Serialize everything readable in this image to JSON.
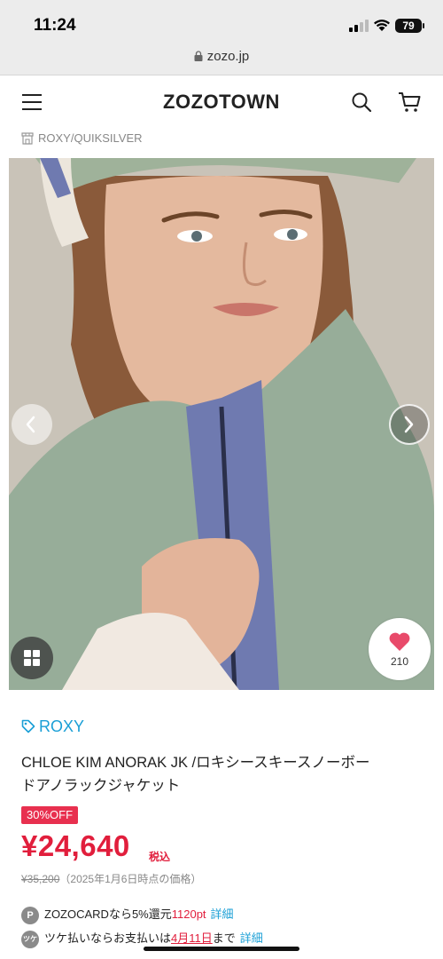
{
  "status_bar": {
    "time": "11:24",
    "battery": "79"
  },
  "browser": {
    "url": "zozo.jp"
  },
  "header": {
    "brand": "ZOZOTOWN"
  },
  "shop": {
    "name": "ROXY/QUIKSILVER"
  },
  "hero": {
    "favorite_count": "210"
  },
  "product": {
    "brand": "ROXY",
    "title_line1": "CHLOE KIM ANORAK JK /ロキシースキースノーボー",
    "title_line2": "ドアノラックジャケット",
    "discount": "30%OFF",
    "price": "¥24,640",
    "tax_label": "税込",
    "original_price": "¥35,200",
    "original_price_note": "（2025年1月6日時点の価格）"
  },
  "points": {
    "icon": "P",
    "text": "ZOZOCARDなら5%還元",
    "value": "1120pt",
    "link": "詳細"
  },
  "payment": {
    "icon": "ツケ",
    "text_before": "ツケ払いならお支払いは",
    "date": "4月11日",
    "text_after": "まで",
    "link": "詳細"
  },
  "colors": {
    "accent_blue": "#1a9fd6",
    "price_red": "#e11e3c",
    "badge_red": "#e8304f"
  }
}
